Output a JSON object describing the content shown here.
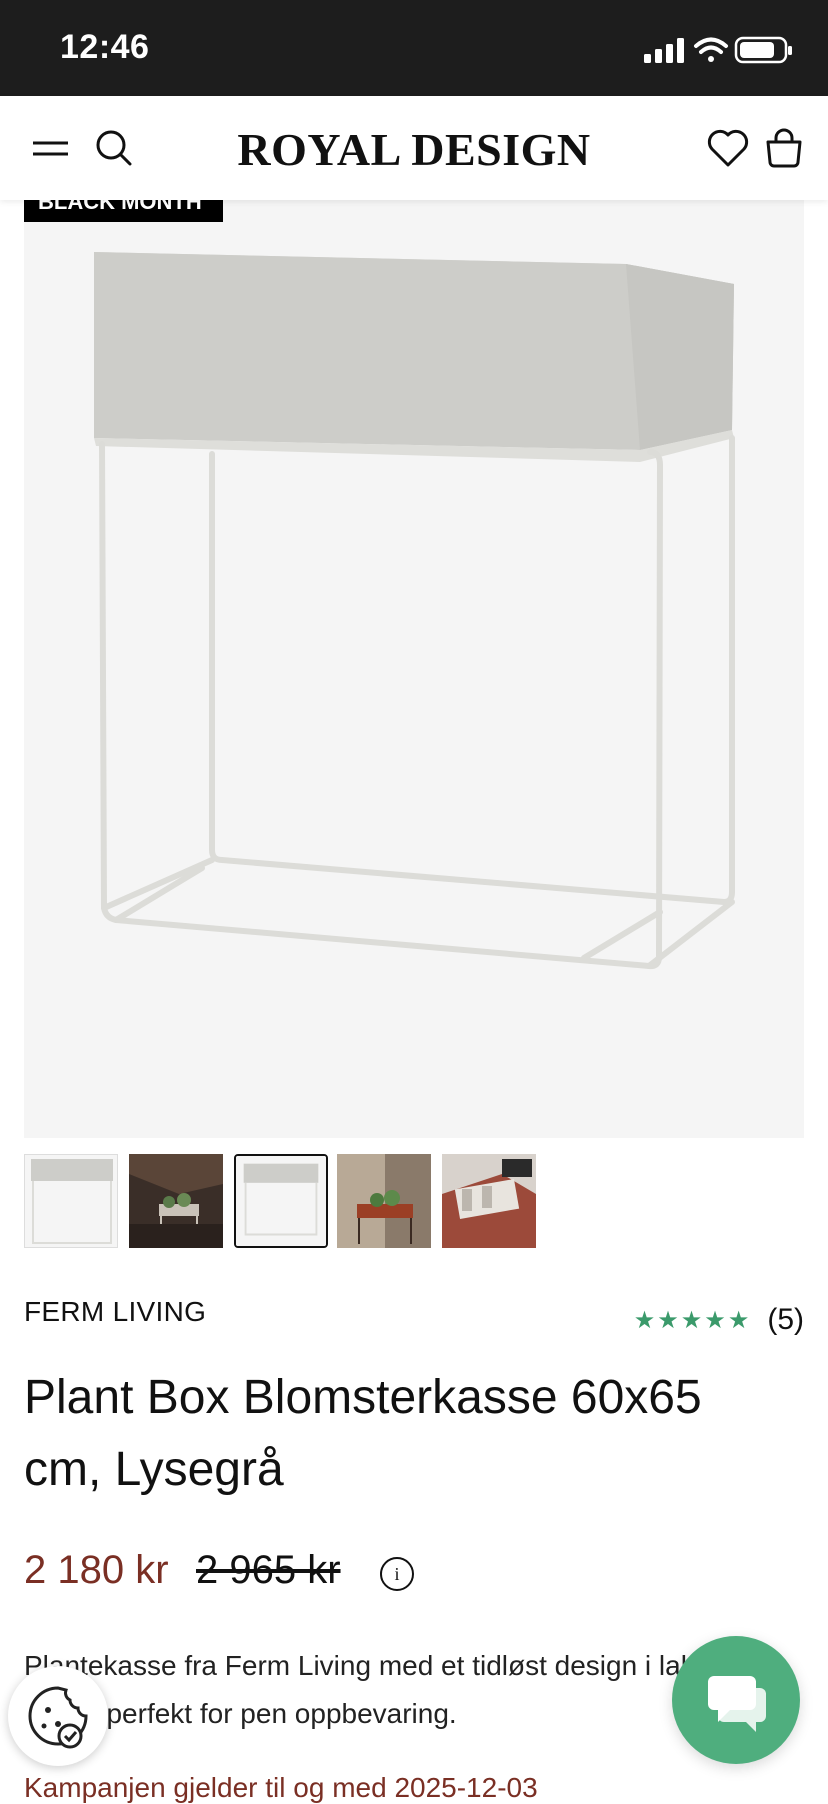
{
  "status_bar": {
    "time": "12:46"
  },
  "header": {
    "logo": "ROYAL DESIGN"
  },
  "badge": {
    "label": "BLACK MONTH"
  },
  "product": {
    "brand": "FERM LIVING",
    "rating_stars": "★★★★★",
    "rating_count": "(5)",
    "title": "Plant Box Blomsterkasse 60x65 cm, Lysegrå",
    "price": "2 180 kr",
    "old_price": "2 965 kr",
    "info_icon": "i",
    "description": "Plantekasse fra Ferm Living med et tidløst design i lakkert metall perfekt for pen oppbevaring.",
    "campaign": "Kampanjen gjelder til og med 2025-12-03"
  },
  "colors": {
    "accent_green": "#4fae7e",
    "price_red": "#7a2f24",
    "status_bar": "#1d1d1d"
  },
  "icons": [
    "menu-icon",
    "search-icon",
    "heart-icon",
    "bag-icon",
    "info-icon",
    "chat-icon",
    "cookie-icon"
  ]
}
